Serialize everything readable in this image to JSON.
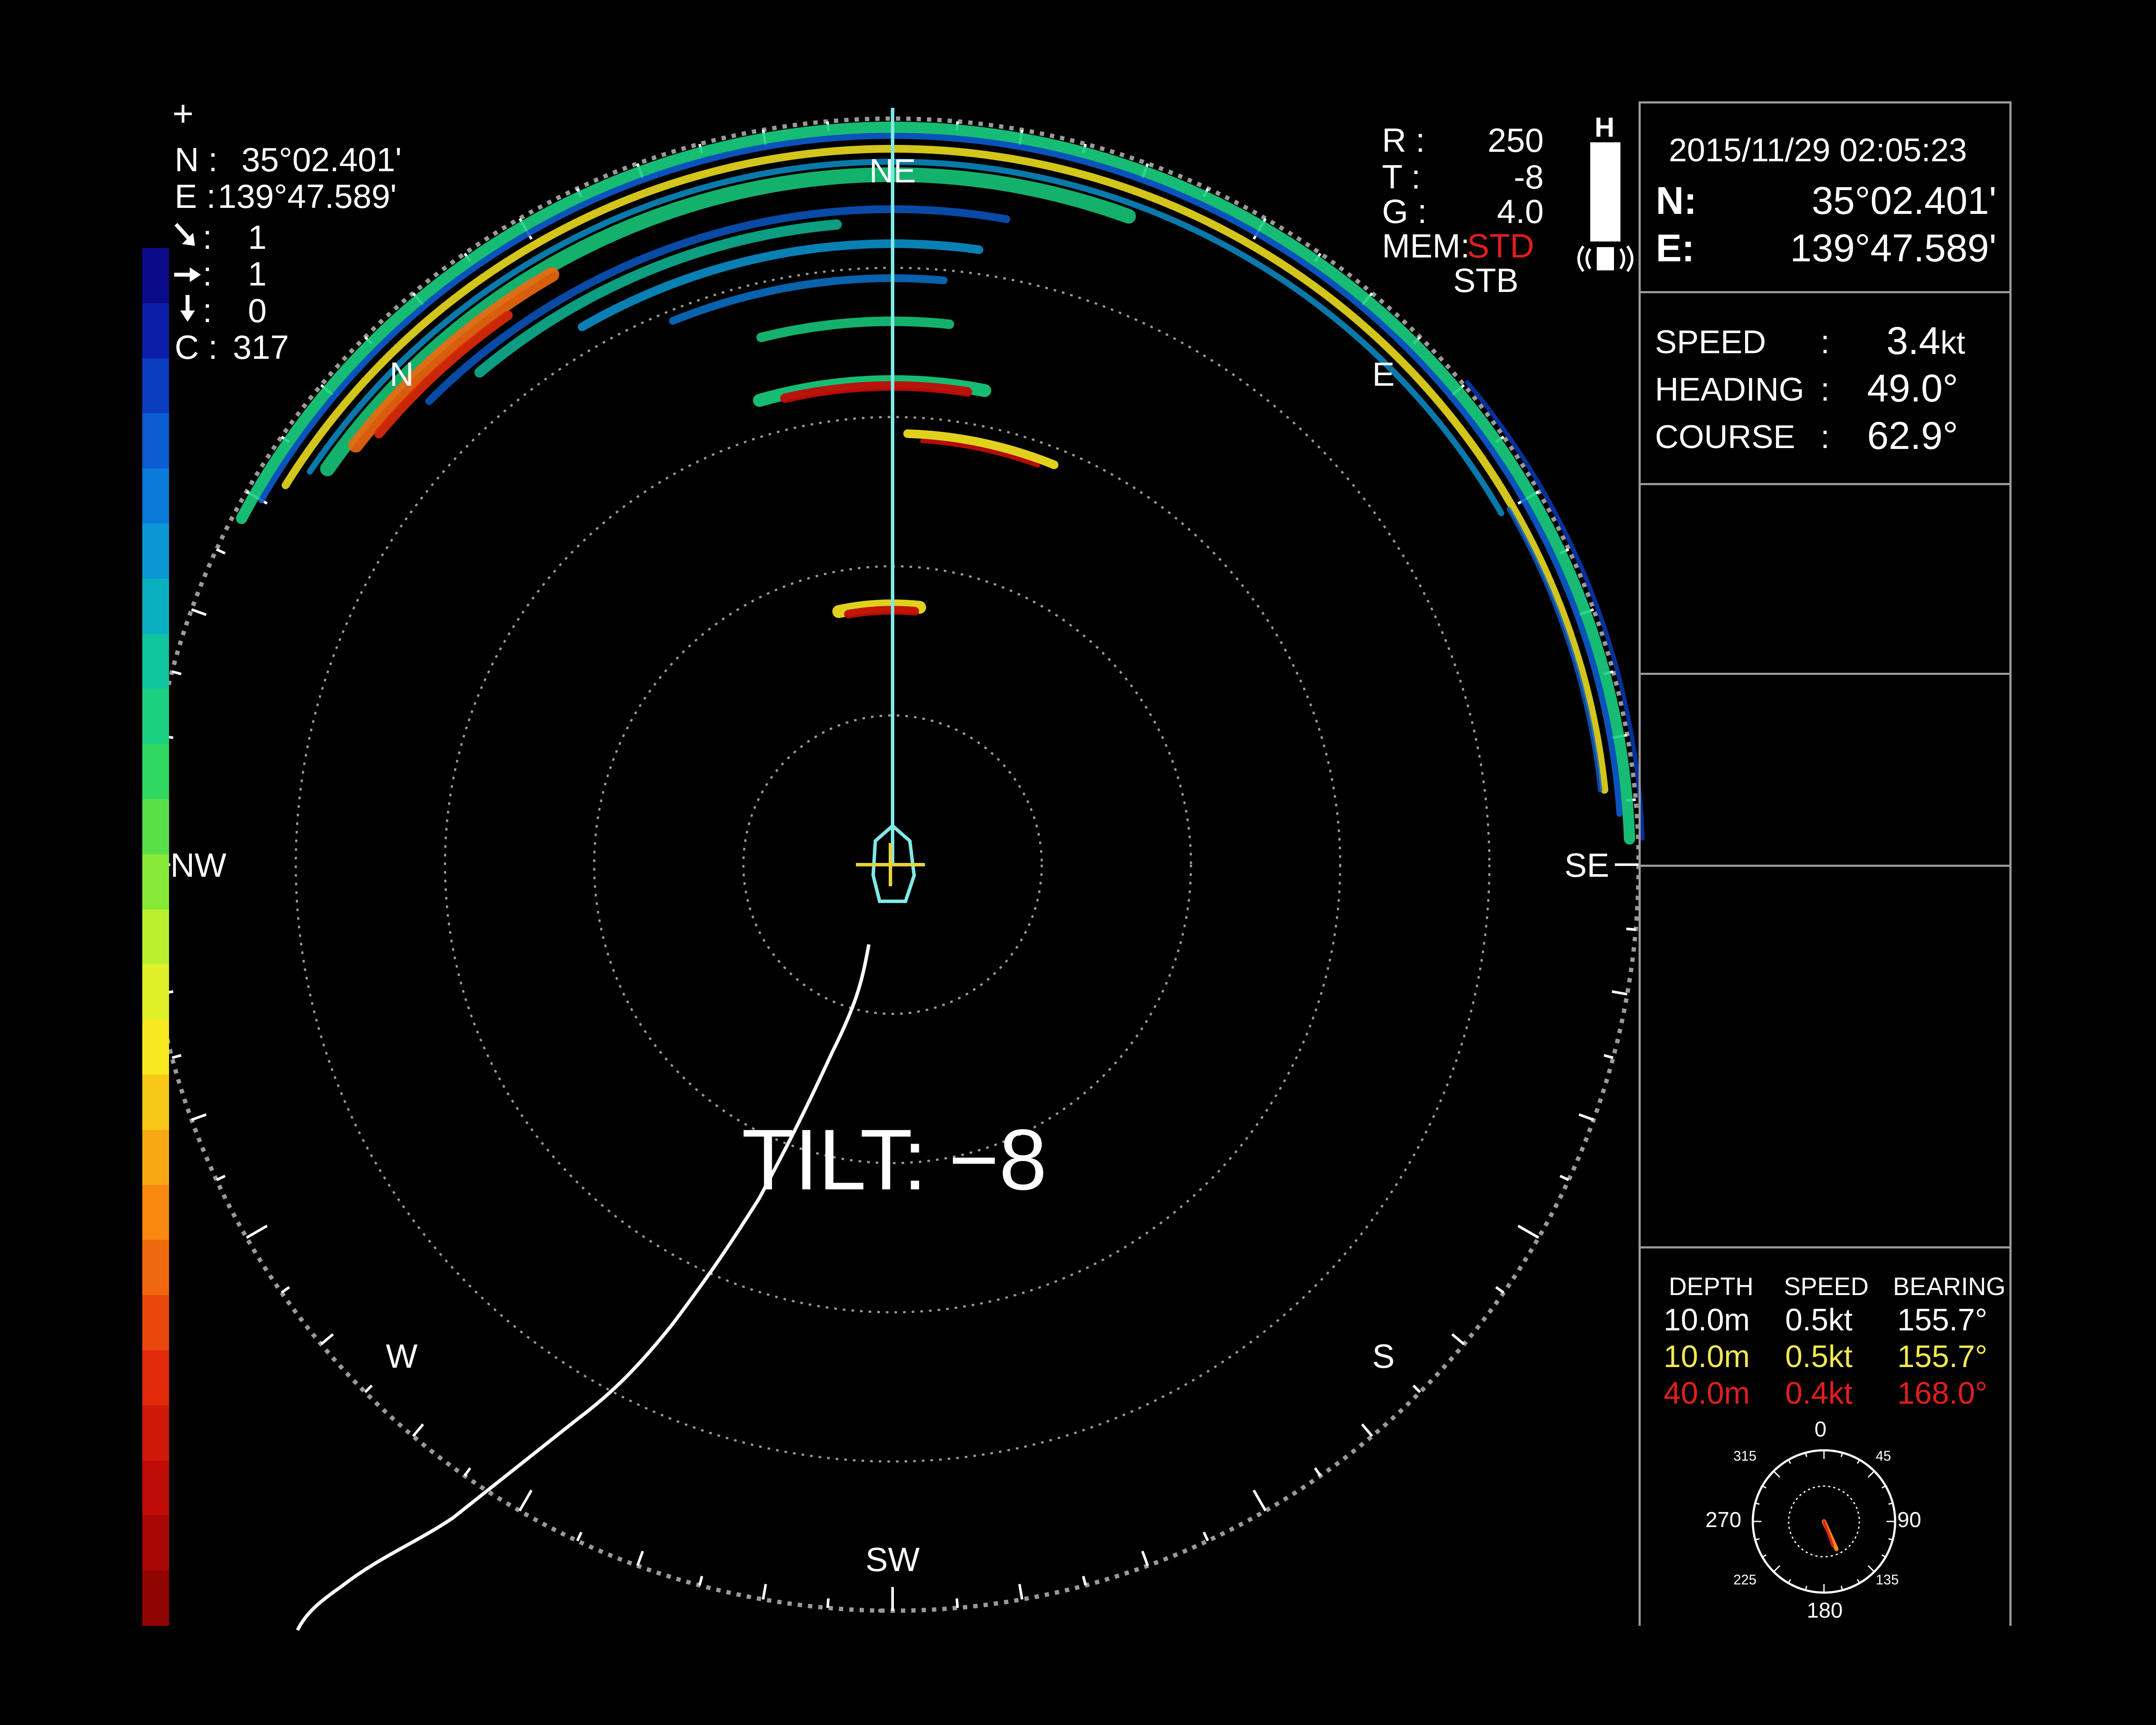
{
  "colors": {
    "background": "#000000",
    "text": "#ffffff",
    "secondary_color": "#f2e94e",
    "tertiary_color": "#e01e1e",
    "heading_line": "#7fe9e6",
    "range_rings": "#9a9a9a",
    "ship": "#7fe9e6",
    "cursor": "#e8d23a"
  },
  "top_left_info": {
    "crosshair_symbol": "+",
    "lat_label": "N :",
    "lat_value": "35°02.401'",
    "lon_label": "E :",
    "lon_value": "139°47.589'",
    "row1_icon": "diagonal-arrow-icon",
    "row1_sep": ":",
    "row1_value": "1",
    "row2_icon": "right-arrow-icon",
    "row2_sep": ":",
    "row2_value": "1",
    "row3_icon": "down-arrow-icon",
    "row3_sep": ":",
    "row3_value": "0",
    "c_label": "C :",
    "c_value": "317"
  },
  "color_scale": {
    "levels": [
      "#0b0b8a",
      "#0a1ea8",
      "#0a3cc0",
      "#0a5cd0",
      "#0a7ad8",
      "#0a97d4",
      "#0ab0c0",
      "#10c4a0",
      "#18d080",
      "#30d860",
      "#58e048",
      "#88e838",
      "#b8f030",
      "#e0f028",
      "#f8e820",
      "#f8c818",
      "#f8a814",
      "#f88810",
      "#f0680e",
      "#e8480c",
      "#e02a0a",
      "#d01808",
      "#c00c06",
      "#a80604",
      "#900402"
    ]
  },
  "radar_settings": {
    "r_label": "R :",
    "r_value": "250",
    "t_label": "T :",
    "t_value": "-8",
    "g_label": "G :",
    "g_value": "4.0",
    "mem_label": "MEM:",
    "mem_value": "STD",
    "stb_label": "STB"
  },
  "mode_indicator": {
    "label": "H"
  },
  "status_panel": {
    "datetime": "2015/11/29 02:05:23",
    "lat_label": "N:",
    "lat_value": "35°02.401'",
    "lon_label": "E:",
    "lon_value": "139°47.589'",
    "speed_label": "SPEED",
    "speed_sep": ":",
    "speed_value": "3.4",
    "speed_unit": "kt",
    "heading_label": "HEADING",
    "heading_sep": ":",
    "heading_value": "49.0°",
    "course_label": "COURSE",
    "course_sep": ":",
    "course_value": "62.9°"
  },
  "current_table": {
    "headers": [
      "DEPTH",
      "SPEED",
      "BEARING"
    ],
    "rows": [
      {
        "depth": "10.0m",
        "speed": "0.5kt",
        "bearing": "155.7°",
        "color": "#ffffff"
      },
      {
        "depth": "10.0m",
        "speed": "0.5kt",
        "bearing": "155.7°",
        "color": "#f2e94e"
      },
      {
        "depth": "40.0m",
        "speed": "0.4kt",
        "bearing": "168.0°",
        "color": "#e01e1e"
      }
    ]
  },
  "compass_rose": {
    "labels": {
      "n": "0",
      "ne": "45",
      "e": "90",
      "se": "135",
      "s": "180",
      "sw": "225",
      "w": "270",
      "nw": "315"
    },
    "needle_bearing_deg": 155.7
  },
  "sonar": {
    "heading_deg": 49.0,
    "bearing_labels": [
      "N",
      "NE",
      "E",
      "SE",
      "S",
      "SW",
      "W",
      "NW"
    ],
    "tilt_label": "TILT:",
    "tilt_value": "−8"
  }
}
